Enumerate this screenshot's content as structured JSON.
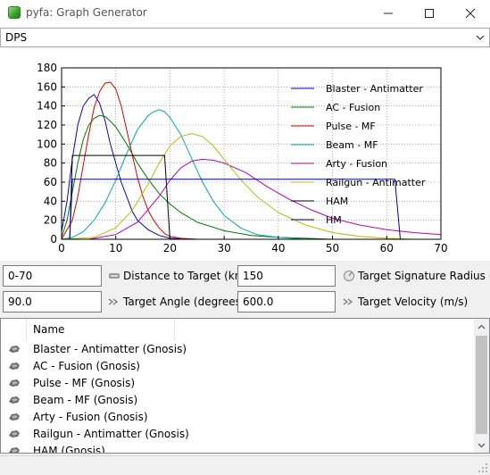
{
  "window": {
    "title": "pyfa: Graph Generator",
    "minimize_glyph": "—",
    "maximize_glyph": "☐",
    "close_glyph": "✕",
    "icon": "pyfa-app-icon"
  },
  "graph_select": {
    "value": "DPS",
    "icon": "chevron-down-icon"
  },
  "controls": {
    "distance": {
      "value": "0-70",
      "label": "Distance to Target (km)",
      "icon": "distance-icon"
    },
    "signature": {
      "value": "150",
      "label": "Target Signature Radius (m)",
      "icon": "signature-icon"
    },
    "angle": {
      "value": "90.0",
      "label": "Target Angle (degrees)",
      "icon": "angle-icon"
    },
    "velocity": {
      "value": "600.0",
      "label": "Target Velocity (m/s)",
      "icon": "velocity-icon"
    }
  },
  "fit_list": {
    "header_name": "Name",
    "row_icon": "ship-icon",
    "rows": [
      "Blaster - Antimatter (Gnosis)",
      "AC - Fusion (Gnosis)",
      "Pulse - MF (Gnosis)",
      "Beam - MF (Gnosis)",
      "Arty - Fusion (Gnosis)",
      "Railgun - Antimatter (Gnosis)",
      "HAM (Gnosis)"
    ]
  },
  "chart_data": {
    "type": "line",
    "title": "",
    "xlabel": "",
    "ylabel": "",
    "xlim": [
      0,
      70
    ],
    "ylim": [
      0,
      180
    ],
    "x_ticks": [
      0,
      10,
      20,
      30,
      40,
      50,
      60,
      70
    ],
    "y_ticks": [
      0,
      20,
      40,
      60,
      80,
      100,
      120,
      140,
      160,
      180
    ],
    "grid": true,
    "legend_position": "right",
    "series": [
      {
        "name": "Blaster - Antimatter",
        "color": "#0000cc",
        "x": [
          0,
          1,
          2,
          3,
          4,
          5,
          6,
          7,
          8,
          9,
          10,
          11,
          12,
          13,
          14,
          16,
          18,
          20,
          25,
          30
        ],
        "y": [
          8,
          40,
          85,
          120,
          140,
          148,
          152,
          143,
          125,
          100,
          80,
          60,
          45,
          30,
          20,
          10,
          4,
          1,
          0,
          0
        ]
      },
      {
        "name": "AC - Fusion",
        "color": "#007700",
        "x": [
          0,
          1,
          2,
          3,
          4,
          5,
          6,
          7,
          8,
          9,
          10,
          12,
          14,
          16,
          18,
          20,
          22,
          25,
          30,
          35,
          40,
          45,
          50
        ],
        "y": [
          2,
          20,
          50,
          80,
          105,
          120,
          127,
          130,
          129,
          124,
          118,
          100,
          80,
          63,
          48,
          37,
          28,
          18,
          9,
          4,
          2,
          1,
          0
        ]
      },
      {
        "name": "Pulse - MF",
        "color": "#dd0000",
        "x": [
          0,
          2,
          3,
          4,
          5,
          6,
          7,
          8,
          9,
          10,
          11,
          12,
          13,
          14,
          15,
          16,
          17,
          18,
          19,
          20,
          22,
          25
        ],
        "y": [
          0,
          20,
          45,
          78,
          110,
          138,
          155,
          164,
          165,
          158,
          140,
          115,
          90,
          65,
          45,
          30,
          20,
          12,
          6,
          3,
          1,
          0
        ]
      },
      {
        "name": "Beam - MF",
        "color": "#00aaaa",
        "x": [
          0,
          2,
          4,
          6,
          8,
          10,
          12,
          14,
          16,
          17,
          18,
          19,
          20,
          22,
          24,
          26,
          28,
          30,
          33,
          36,
          40,
          45
        ],
        "y": [
          0,
          2,
          8,
          20,
          38,
          62,
          90,
          115,
          130,
          134,
          136,
          134,
          128,
          110,
          85,
          60,
          40,
          25,
          12,
          5,
          2,
          0
        ]
      },
      {
        "name": "Arty - Fusion",
        "color": "#bb00bb",
        "x": [
          0,
          5,
          10,
          14,
          18,
          20,
          22,
          24,
          26,
          28,
          30,
          34,
          38,
          42,
          46,
          50,
          55,
          60,
          65,
          70
        ],
        "y": [
          0,
          0,
          5,
          18,
          45,
          62,
          75,
          82,
          84,
          83,
          80,
          70,
          55,
          42,
          31,
          22,
          15,
          10,
          7,
          5
        ]
      },
      {
        "name": "Railgun - Antimatter",
        "color": "#bbbb00",
        "x": [
          0,
          6,
          10,
          13,
          16,
          18,
          20,
          22,
          24,
          26,
          28,
          30,
          33,
          36,
          40,
          45,
          50,
          55,
          60,
          65
        ],
        "y": [
          0,
          2,
          12,
          30,
          58,
          80,
          98,
          108,
          111,
          108,
          98,
          84,
          63,
          45,
          28,
          15,
          7,
          3,
          1,
          0
        ]
      },
      {
        "name": "HAM",
        "color": "#000000",
        "x": [
          1.5,
          2,
          19,
          20,
          21,
          70
        ],
        "y": [
          0,
          88,
          88,
          0,
          0,
          0
        ]
      },
      {
        "name": "HM",
        "color": "#0000aa",
        "x": [
          1.5,
          2,
          61.5,
          62.5,
          63,
          70
        ],
        "y": [
          0,
          63,
          63,
          0,
          0,
          0
        ]
      }
    ]
  }
}
